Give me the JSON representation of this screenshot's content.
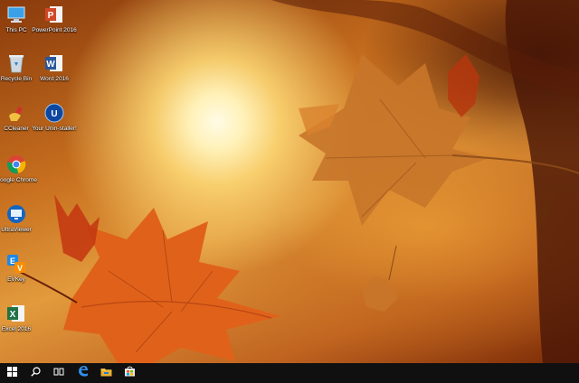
{
  "desktop": {
    "icons": [
      {
        "label": "This PC",
        "icon": "computer-icon"
      },
      {
        "label": "PowerPoint 2016",
        "icon": "powerpoint-icon"
      },
      {
        "label": "Recycle Bin",
        "icon": "recycle-bin-icon"
      },
      {
        "label": "Word 2016",
        "icon": "word-icon"
      },
      {
        "label": "CCleaner",
        "icon": "ccleaner-icon"
      },
      {
        "label": "Your Unin-staller!",
        "icon": "uninstaller-icon"
      },
      {
        "label": "Google Chrome",
        "icon": "chrome-icon"
      },
      {
        "label": "UltraViewer",
        "icon": "ultraviewer-icon"
      },
      {
        "label": "EVKey",
        "icon": "evkey-icon"
      },
      {
        "label": "Excel 2016",
        "icon": "excel-icon"
      }
    ]
  },
  "taskbar": {
    "items": [
      "windows-start-icon",
      "search-icon",
      "task-view-icon",
      "edge-icon",
      "file-explorer-icon",
      "store-icon"
    ],
    "background": "#101010"
  },
  "wallpaper": {
    "theme": "autumn-leaves",
    "colors": {
      "sun": "#fff6d0",
      "leaf": "#e0621a",
      "sky": "#d98a2c"
    }
  }
}
